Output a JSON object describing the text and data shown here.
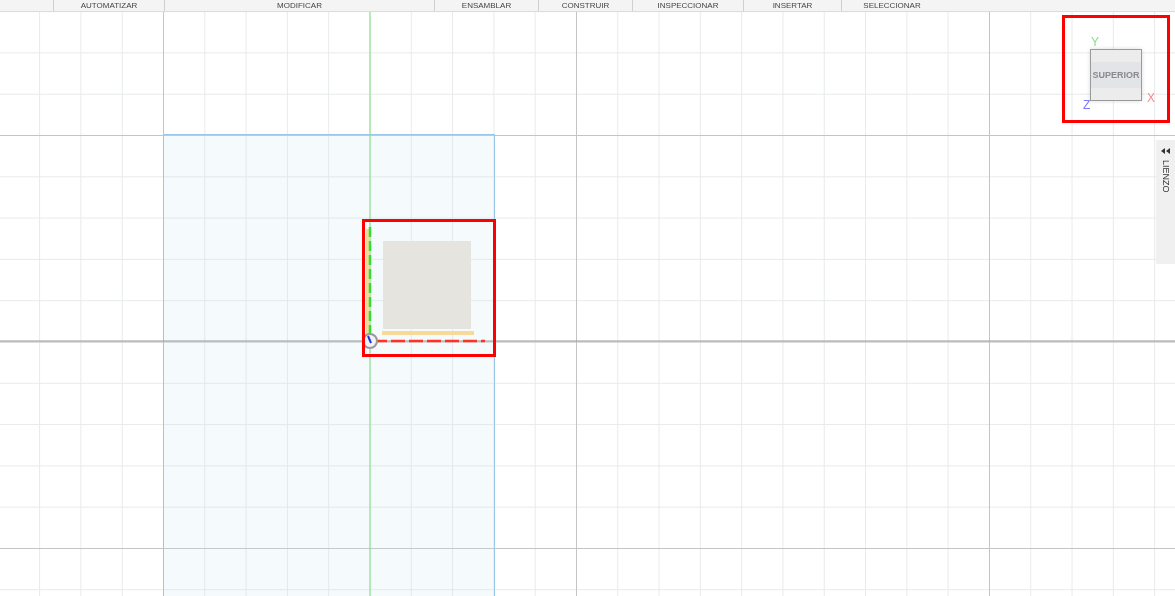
{
  "toolbar": {
    "tabs": [
      {
        "label": "AUTOMATIZAR"
      },
      {
        "label": "MODIFICAR"
      },
      {
        "label": "ENSAMBLAR"
      },
      {
        "label": "CONSTRUIR"
      },
      {
        "label": "INSPECCIONAR"
      },
      {
        "label": "INSERTAR"
      },
      {
        "label": "SELECCIONAR"
      }
    ]
  },
  "view_cube": {
    "face": "SUPERIOR",
    "axes": {
      "x": "X",
      "y": "Y",
      "z": "Z"
    }
  },
  "side_panel": {
    "label": "LIENZO"
  }
}
